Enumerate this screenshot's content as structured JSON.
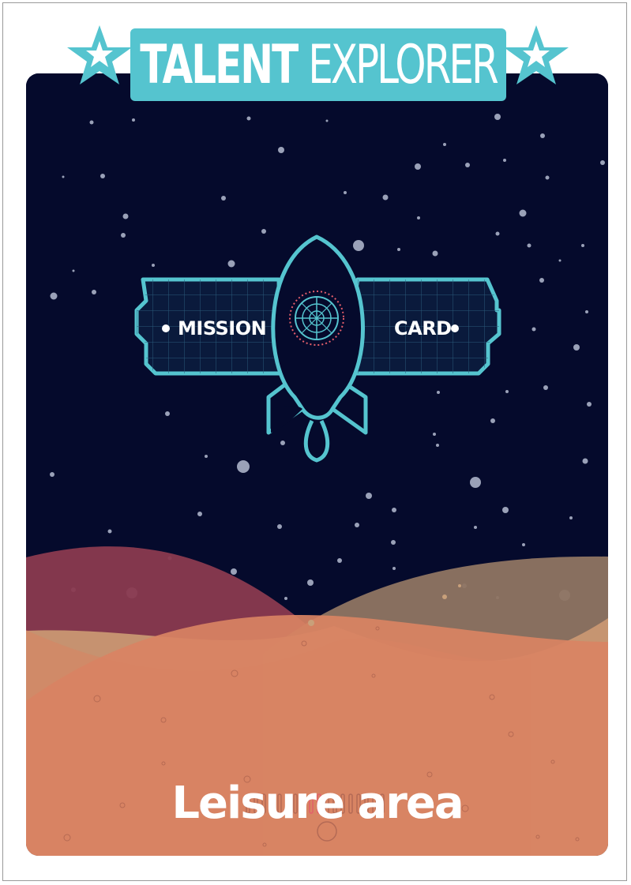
{
  "brand": {
    "bold": "TALENT",
    "light": "EXPLORER"
  },
  "badge": {
    "left_label": "MISSION",
    "right_label": "CARD"
  },
  "card": {
    "title": "Leisure area"
  },
  "colors": {
    "sky": "#050a2c",
    "accent": "#55c4cf",
    "dune_front": "#d98363",
    "dune_maroon": "#8a3a4f",
    "dune_brown": "#8f7562",
    "dune_tan": "#c99772",
    "gauge_active": "#e35e6b"
  },
  "icons": [
    "star-icon",
    "rocket-icon",
    "radar-icon"
  ]
}
